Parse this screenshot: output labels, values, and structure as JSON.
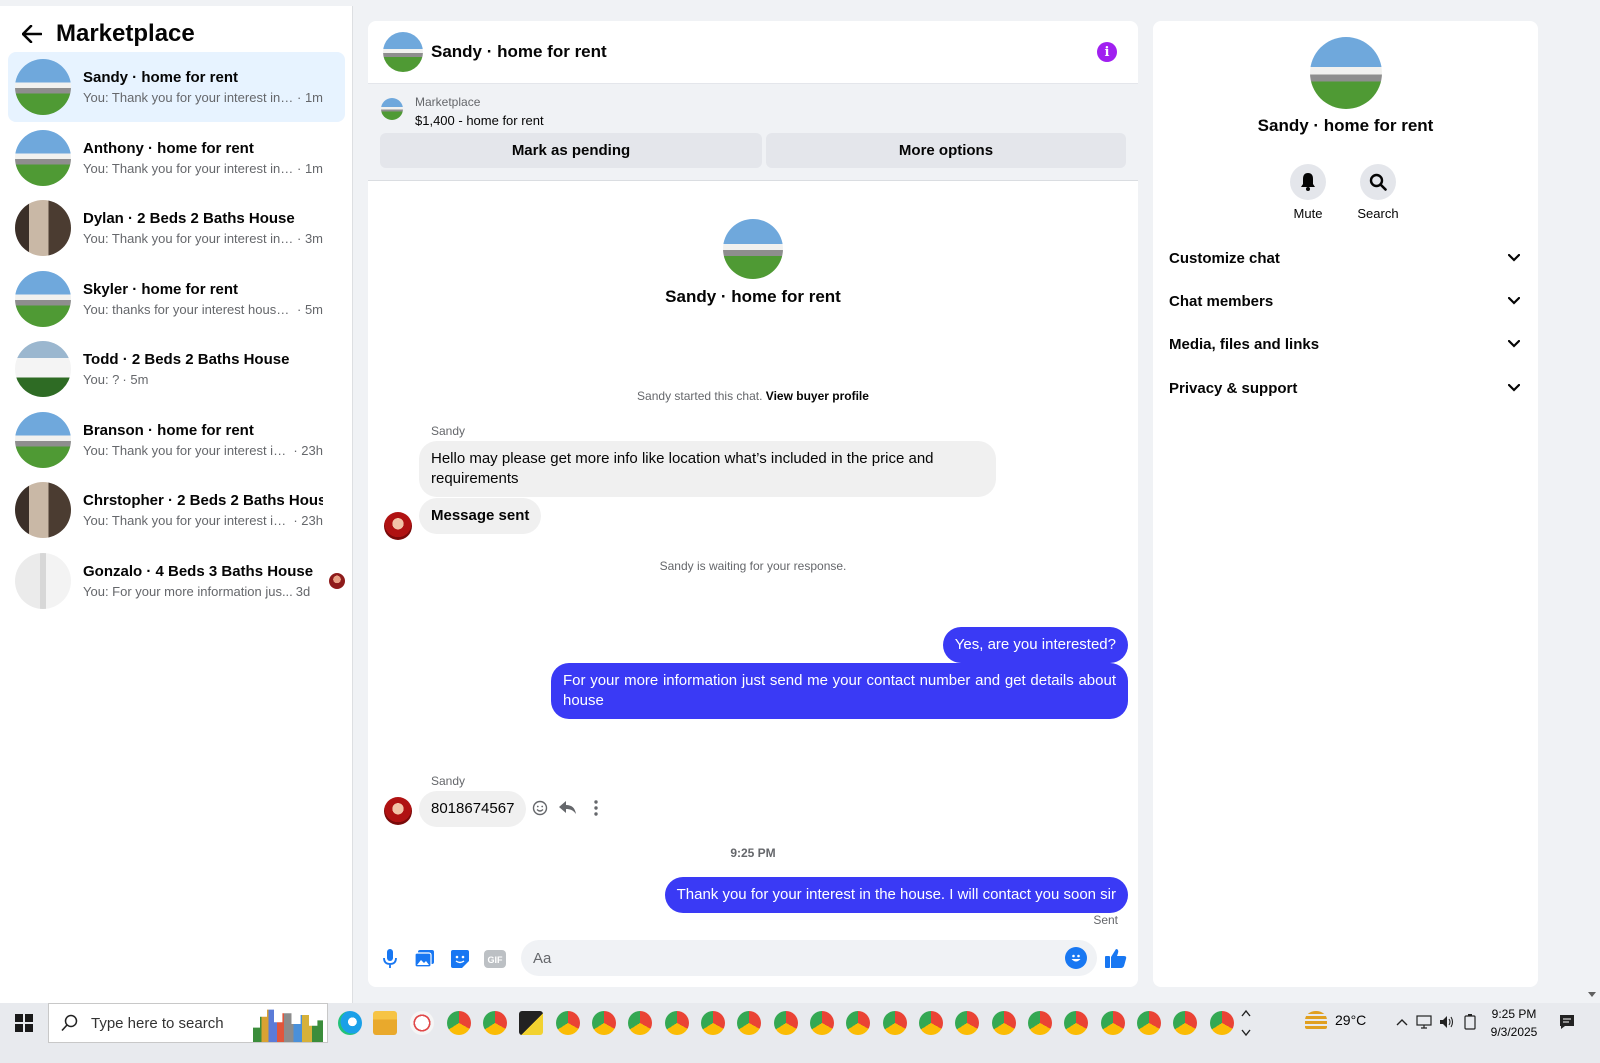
{
  "sidebar": {
    "title": "Marketplace",
    "conversations": [
      {
        "name": "Sandy · home for rent",
        "preview": "You: Thank you for your interest in th...",
        "time": "· 1m",
        "avatar": "house"
      },
      {
        "name": "Anthony · home for rent",
        "preview": "You: Thank you for your interest in th...",
        "time": "· 1m",
        "avatar": "house"
      },
      {
        "name": "Dylan · 2 Beds 2 Baths House",
        "preview": "You: Thank you for your interest in th...",
        "time": "· 3m",
        "avatar": "interior"
      },
      {
        "name": "Skyler · home for rent",
        "preview": "You: thanks for your interest house w...",
        "time": "· 5m",
        "avatar": "house"
      },
      {
        "name": "Todd · 2 Beds 2 Baths House",
        "preview": "You: ?",
        "time": "· 5m",
        "avatar": "white-house"
      },
      {
        "name": "Branson · home for rent",
        "preview": "You: Thank you for your interest in t...",
        "time": "· 23h",
        "avatar": "house"
      },
      {
        "name": "Chrstopher · 2 Beds 2 Baths House",
        "preview": "You: Thank you for your interest in t...",
        "time": "· 23h",
        "avatar": "interior"
      },
      {
        "name": "Gonzalo · 4 Beds 3 Baths House",
        "preview": "You: For your more information jus...",
        "time": "3d",
        "avatar": "room"
      }
    ]
  },
  "chat": {
    "title": "Sandy · home for rent",
    "listing": {
      "source": "Marketplace",
      "title": "$1,400 - home for rent",
      "btn_pending": "Mark as pending",
      "btn_more": "More options"
    },
    "intro_name": "Sandy · home for rent",
    "started_text": "Sandy started this chat.",
    "view_profile": "View buyer profile",
    "sender_name": "Sandy",
    "msg1": "Hello may please get more info like location what’s included in the price and requirements",
    "msg2": "Message sent",
    "waiting_text": "Sandy is waiting for your response.",
    "out1": "Yes, are you interested?",
    "out2": "For your more information just send me  your contact number and get details about house",
    "msg3": "8018674567",
    "time_sep": "9:25 PM",
    "out3": "Thank you for your interest in the house. I will contact you soon sir",
    "status": "Sent",
    "composer_placeholder": "Aa"
  },
  "details": {
    "name": "Sandy · home for rent",
    "mute": "Mute",
    "search": "Search",
    "sections": [
      "Customize chat",
      "Chat members",
      "Media, files and links",
      "Privacy & support"
    ]
  },
  "taskbar": {
    "search_placeholder": "Type here to search",
    "temperature": "29°C",
    "time": "9:25 PM",
    "date": "9/3/2025"
  },
  "colors": {
    "accent": "#1877f2",
    "outgoing_bubble": "#3a3af5",
    "active_conv": "#e7f3ff",
    "info_icon": "#a020f0"
  }
}
